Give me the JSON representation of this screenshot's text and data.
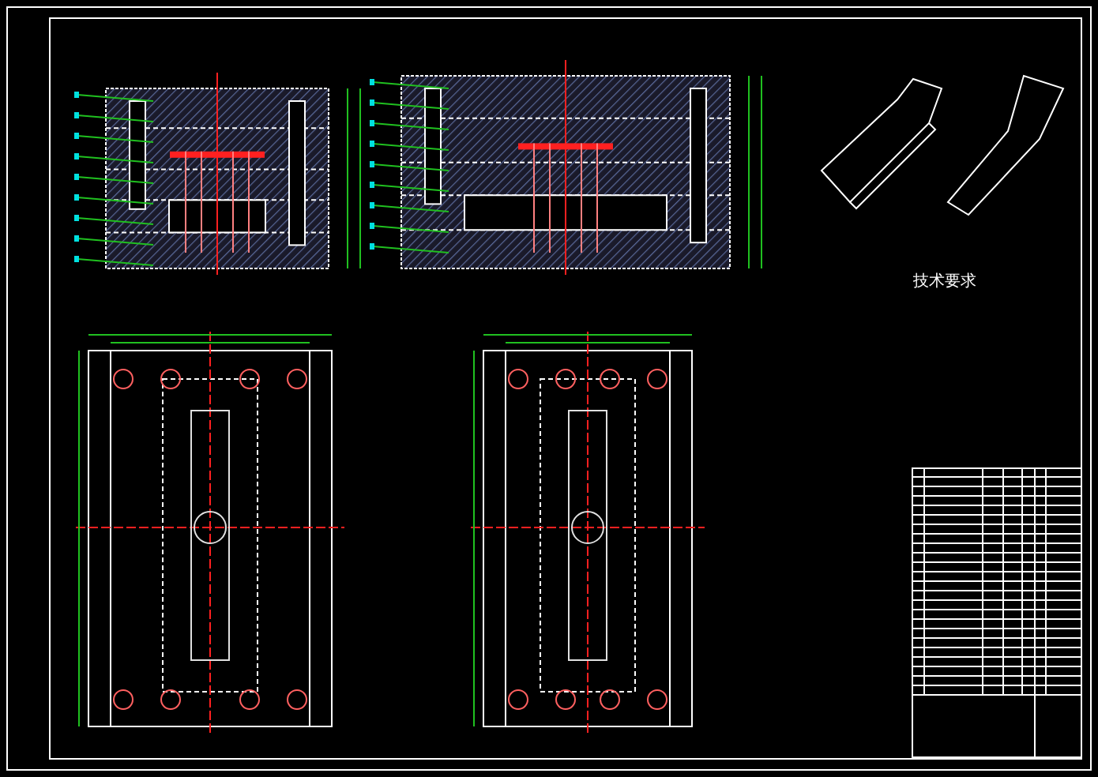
{
  "notes": {
    "title": "技术要求"
  },
  "views": [
    {
      "kind": "section"
    },
    {
      "kind": "section"
    },
    {
      "kind": "plan"
    },
    {
      "kind": "plan"
    },
    {
      "kind": "product"
    },
    {
      "kind": "table"
    }
  ]
}
